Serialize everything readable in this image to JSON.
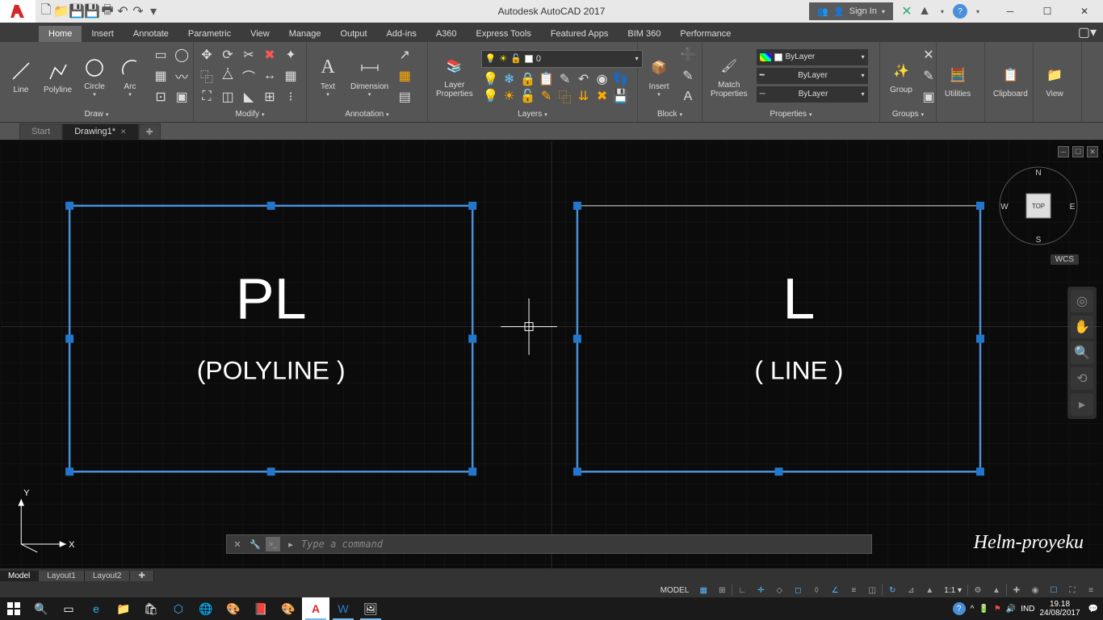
{
  "app": {
    "title": "Autodesk AutoCAD 2017",
    "signin": "Sign In"
  },
  "menus": [
    "Home",
    "Insert",
    "Annotate",
    "Parametric",
    "View",
    "Manage",
    "Output",
    "Add-ins",
    "A360",
    "Express Tools",
    "Featured Apps",
    "BIM 360",
    "Performance"
  ],
  "active_menu": 0,
  "ribbon": {
    "draw": {
      "label": "Draw",
      "line": "Line",
      "polyline": "Polyline",
      "circle": "Circle",
      "arc": "Arc"
    },
    "modify": {
      "label": "Modify"
    },
    "annotation": {
      "label": "Annotation",
      "text": "Text",
      "dimension": "Dimension"
    },
    "layers": {
      "label": "Layers",
      "btn": "Layer\nProperties",
      "current": "0"
    },
    "block": {
      "label": "Block",
      "insert": "Insert"
    },
    "properties": {
      "label": "Properties",
      "match": "Match\nProperties",
      "bylayer": "ByLayer"
    },
    "groups": {
      "label": "Groups",
      "group": "Group"
    },
    "utilities": {
      "label": "Utilities"
    },
    "clipboard": {
      "label": "Clipboard"
    },
    "view": {
      "label": "View"
    }
  },
  "doctabs": {
    "start": "Start",
    "drawing": "Drawing1*"
  },
  "canvas": {
    "pl_title": "PL",
    "pl_sub": "(POLYLINE )",
    "l_title": "L",
    "l_sub": "( LINE )",
    "ucs_y": "Y",
    "ucs_x": "X",
    "cube": {
      "top": "TOP",
      "n": "N",
      "s": "S",
      "e": "E",
      "w": "W"
    },
    "wcs": "WCS"
  },
  "watermark": "Helm-proyeku",
  "cmdline": {
    "placeholder": "Type a command"
  },
  "modeltabs": [
    "Model",
    "Layout1",
    "Layout2"
  ],
  "statusbar": {
    "model": "MODEL",
    "scale": "1:1",
    "lang": "IND"
  },
  "systray": {
    "lang": "IND",
    "time": "19.18",
    "date": "24/08/2017"
  }
}
